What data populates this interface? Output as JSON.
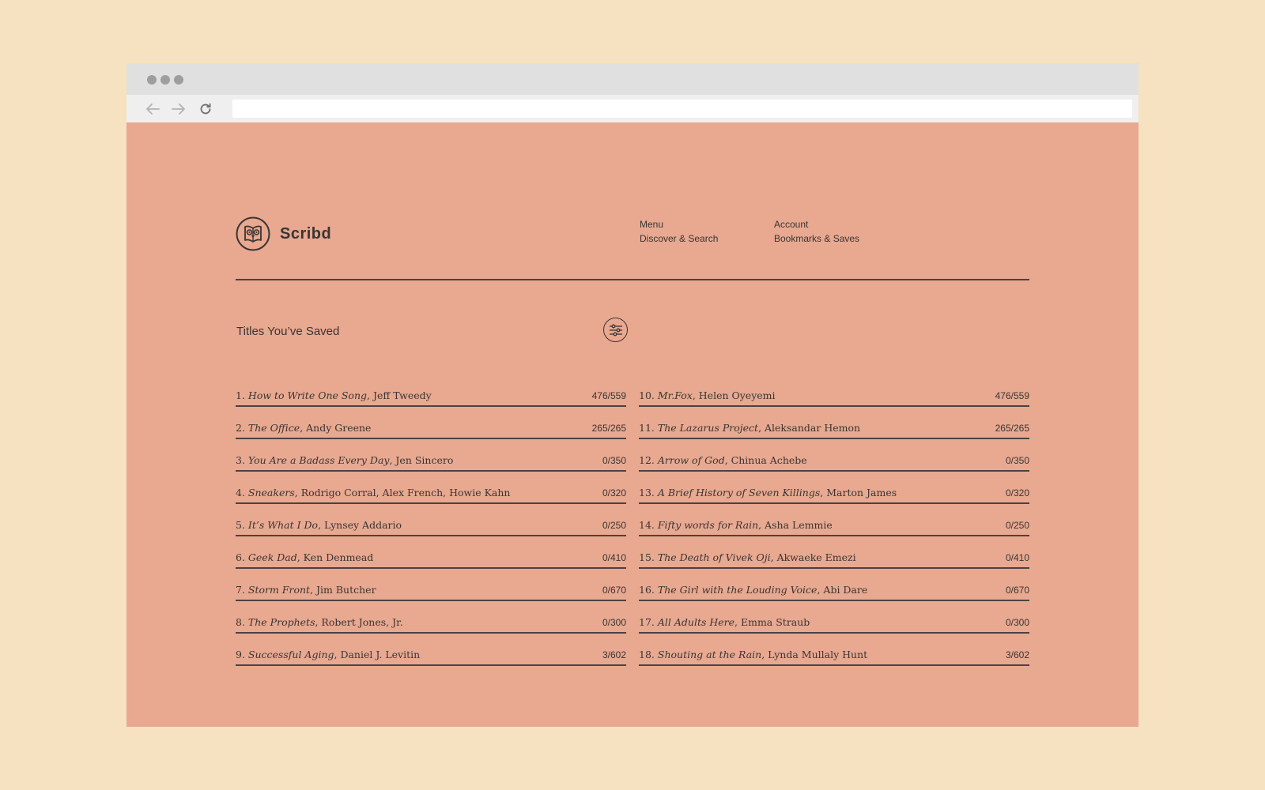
{
  "colors": {
    "backdrop": "#f6e1c1",
    "page_background": "#e8a990",
    "text": "#3a3433",
    "rule": "#4a4242"
  },
  "browser": {
    "window_controls": [
      "close-dot",
      "minimize-dot",
      "maximize-dot"
    ],
    "nav_icons": [
      "back-arrow-icon",
      "forward-arrow-icon",
      "reload-icon"
    ],
    "url_value": ""
  },
  "brand": {
    "name": "Scribd",
    "logo_icon": "owl-book-icon"
  },
  "nav": {
    "col1": {
      "heading": "Menu",
      "link": "Discover & Search"
    },
    "col2": {
      "heading": "Account",
      "link": "Bookmarks & Saves"
    }
  },
  "saved": {
    "title": "Titles You’ve Saved",
    "filter_icon": "sliders-icon",
    "left": [
      {
        "num": "1.",
        "title": "How to Write One Song",
        "author": ", Jeff Tweedy",
        "progress": "476/559"
      },
      {
        "num": "2.",
        "title": "The Office",
        "author": ", Andy Greene",
        "progress": "265/265"
      },
      {
        "num": "3.",
        "title": "You Are a Badass Every Day",
        "author": ", Jen Sincero",
        "progress": "0/350"
      },
      {
        "num": "4.",
        "title": "Sneakers",
        "author": ", Rodrigo Corral, Alex French, Howie Kahn",
        "progress": "0/320"
      },
      {
        "num": "5.",
        "title": "It’s What I Do",
        "author": ", Lynsey Addario",
        "progress": "0/250"
      },
      {
        "num": "6.",
        "title": "Geek Dad",
        "author": ", Ken Denmead",
        "progress": "0/410"
      },
      {
        "num": "7.",
        "title": "Storm Front",
        "author": ", Jim Butcher",
        "progress": "0/670"
      },
      {
        "num": "8.",
        "title": "The Prophets",
        "author": ", Robert Jones, Jr.",
        "progress": "0/300"
      },
      {
        "num": "9.",
        "title": "Successful Aging",
        "author": ", Daniel J. Levitin",
        "progress": "3/602"
      }
    ],
    "right": [
      {
        "num": "10.",
        "title": "Mr.Fox",
        "author": ", Helen Oyeyemi",
        "progress": "476/559"
      },
      {
        "num": "11.",
        "title": "The Lazarus Project",
        "author": ", Aleksandar Hemon",
        "progress": "265/265"
      },
      {
        "num": "12.",
        "title": "Arrow of God",
        "author": ", Chinua Achebe",
        "progress": "0/350"
      },
      {
        "num": "13.",
        "title": "A Brief History of Seven Killings",
        "author": ", Marton James",
        "progress": "0/320"
      },
      {
        "num": "14.",
        "title": "Fifty words for Rain",
        "author": ", Asha Lemmie",
        "progress": "0/250"
      },
      {
        "num": "15.",
        "title": "The Death of Vivek Oji",
        "author": ", Akwaeke Emezi",
        "progress": "0/410"
      },
      {
        "num": "16.",
        "title": "The Girl with the Louding Voice",
        "author": ", Abi Dare",
        "progress": "0/670"
      },
      {
        "num": "17.",
        "title": "All Adults Here",
        "author": ", Emma Straub",
        "progress": "0/300"
      },
      {
        "num": "18.",
        "title": "Shouting at the Rain",
        "author": ", Lynda Mullaly Hunt",
        "progress": "3/602"
      }
    ]
  }
}
